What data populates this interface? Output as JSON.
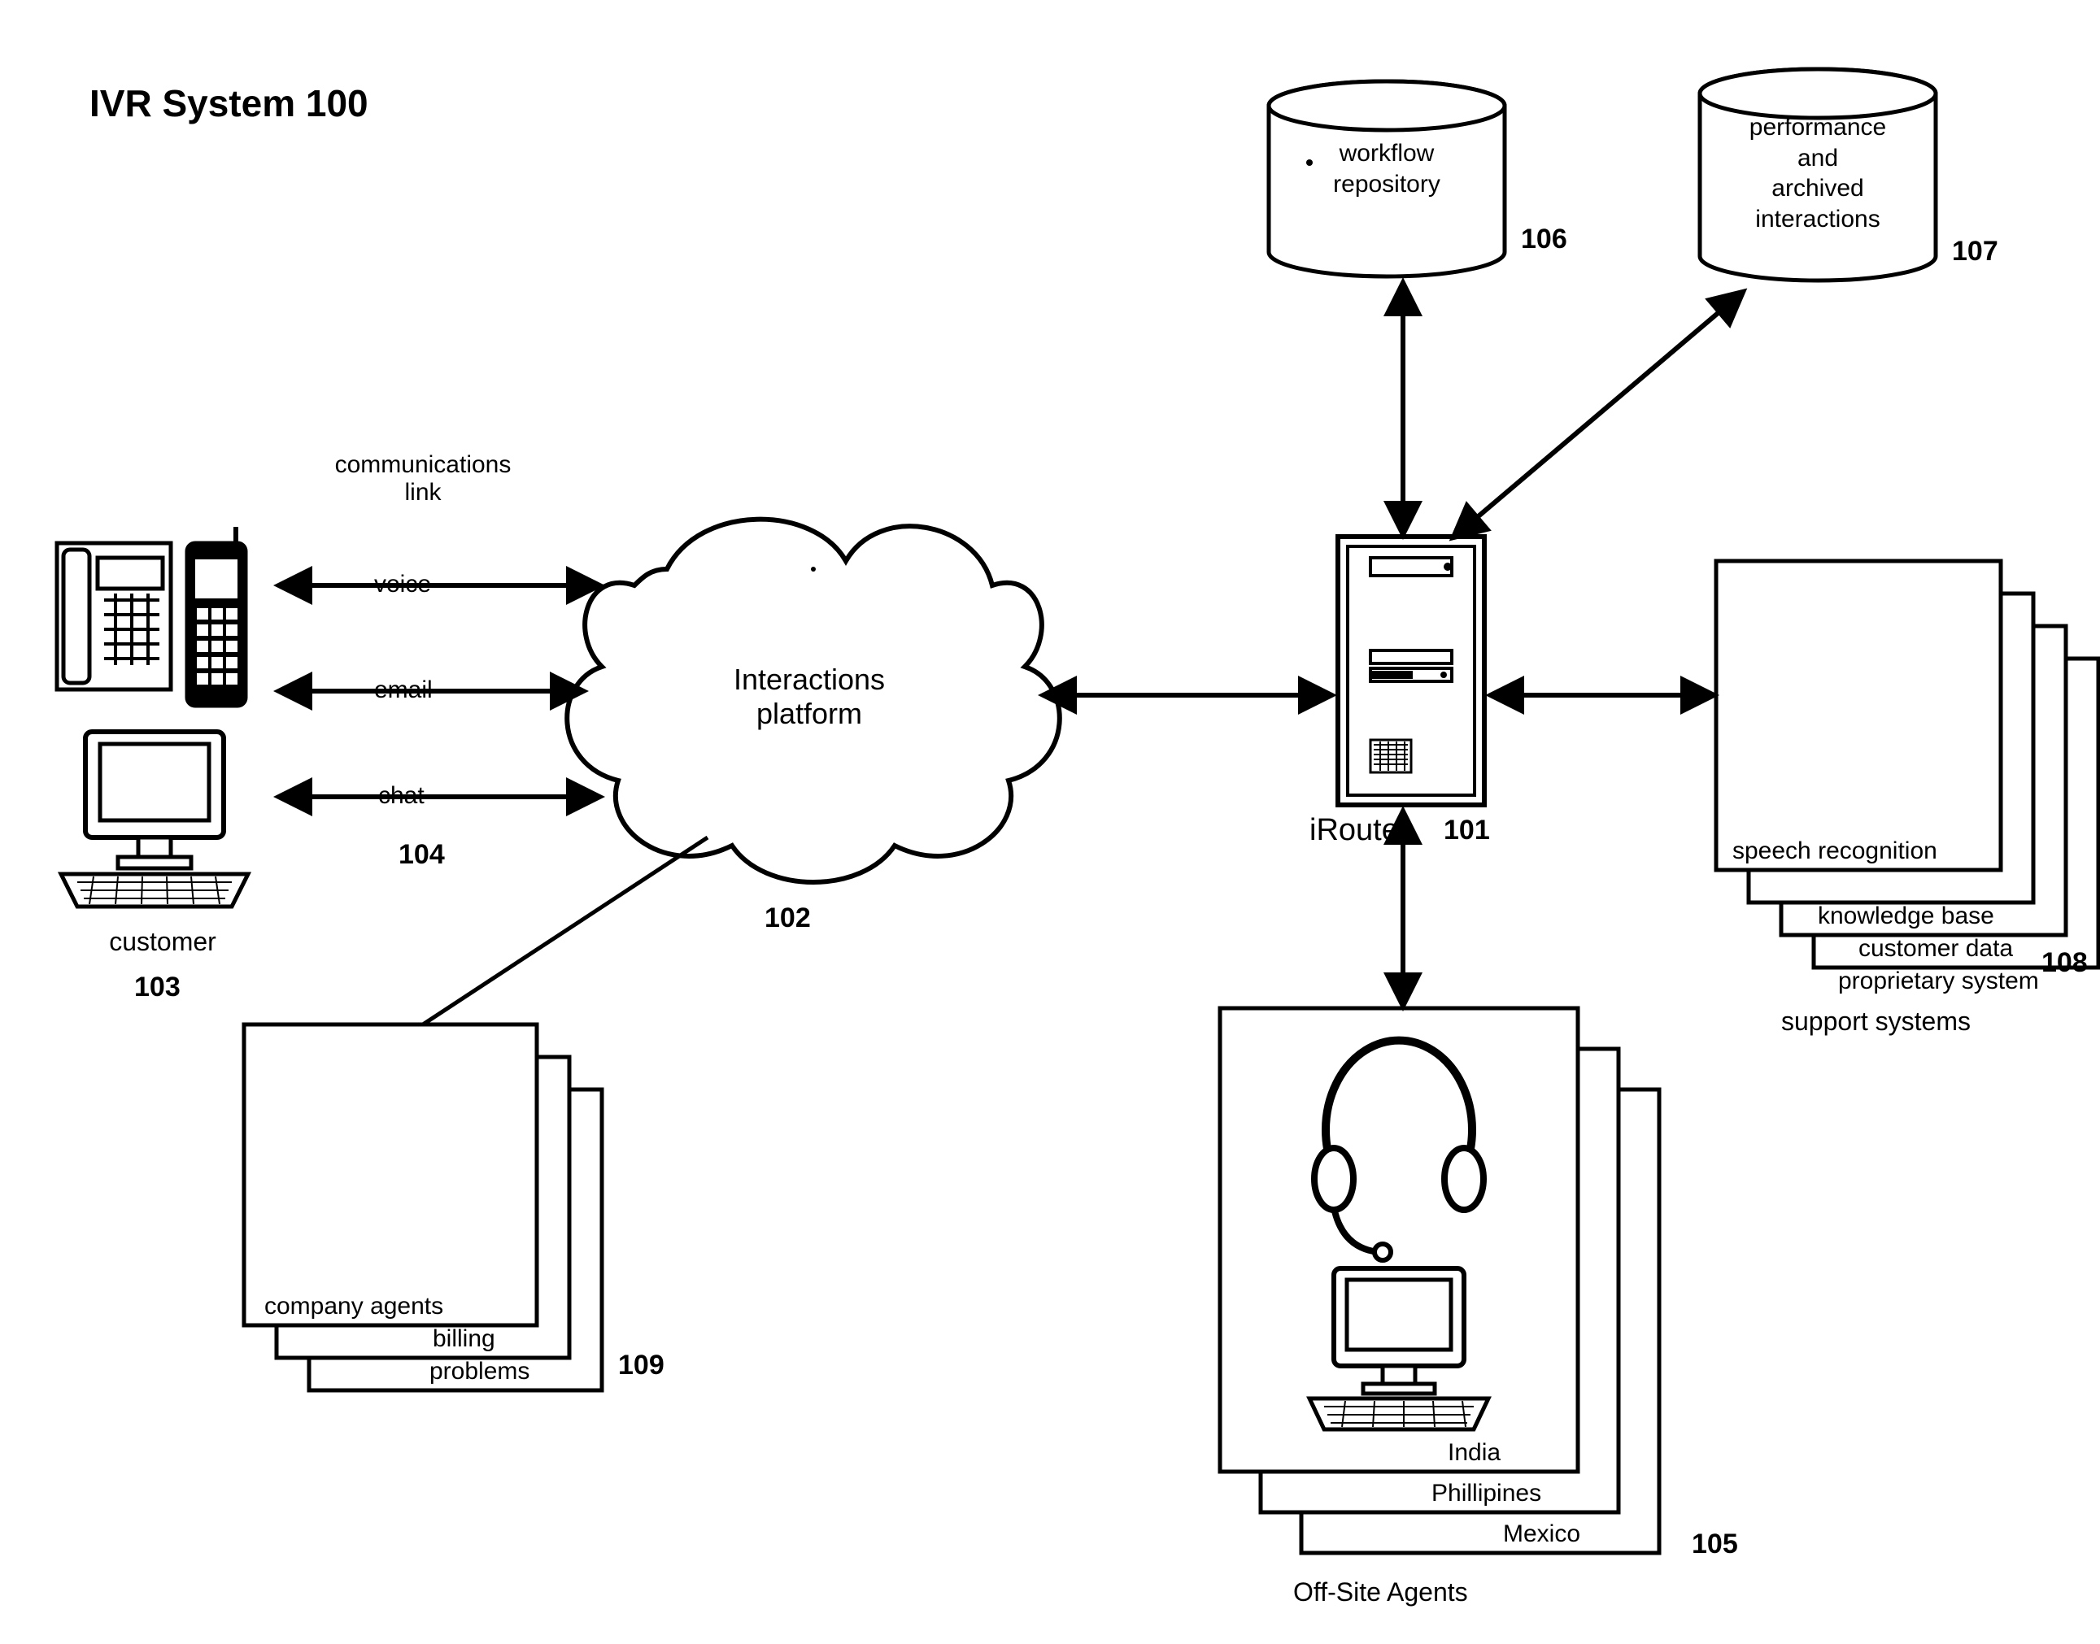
{
  "title": "IVR System 100",
  "nodes": {
    "customer": {
      "label": "customer",
      "num": "103"
    },
    "commlink": {
      "label": "communications\nlink",
      "num": "104",
      "channels": [
        "voice",
        "email",
        "chat"
      ]
    },
    "platform": {
      "label": "Interactions\nplatform",
      "num": "102"
    },
    "irouter": {
      "label": "iRouter",
      "num": "101"
    },
    "workflow": {
      "label": "workflow\nrepository",
      "num": "106"
    },
    "archive": {
      "label": "performance\nand\narchived\ninteractions",
      "num": "107"
    },
    "support": {
      "label": "support systems",
      "num": "108",
      "items": [
        "speech recognition",
        "knowledge base",
        "customer data",
        "proprietary system"
      ]
    },
    "offsite": {
      "label": "Off-Site Agents",
      "num": "105",
      "items": [
        "India",
        "Phillipines",
        "Mexico"
      ]
    },
    "company": {
      "num": "109",
      "items": [
        "company agents",
        "billing",
        "problems"
      ]
    }
  }
}
